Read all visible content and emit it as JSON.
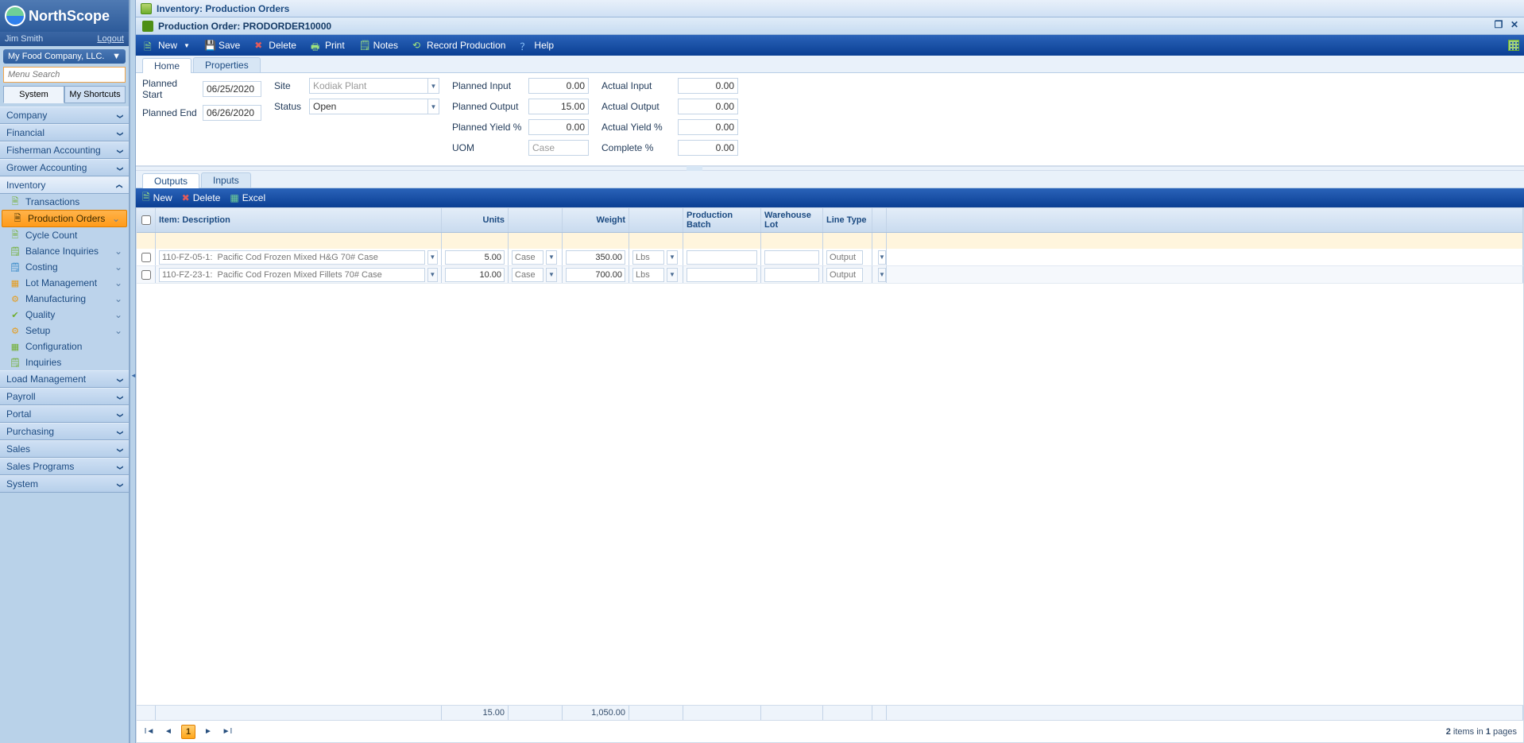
{
  "brand": "NorthScope",
  "user": {
    "name": "Jim Smith",
    "logout": "Logout"
  },
  "company": "My Food Company, LLC.",
  "menu_search_placeholder": "Menu Search",
  "side_tabs": {
    "system": "System",
    "shortcuts": "My Shortcuts"
  },
  "nav_groups_top": [
    "Company",
    "Financial",
    "Fisherman Accounting",
    "Grower Accounting"
  ],
  "nav_inventory": {
    "label": "Inventory",
    "items": [
      {
        "label": "Transactions",
        "icon": "📄",
        "color": "#6fae2e"
      },
      {
        "label": "Production Orders",
        "selected": true,
        "icon": "📋",
        "color": "#fff"
      },
      {
        "label": "Cycle Count",
        "icon": "🗎",
        "color": "#6fae2e"
      },
      {
        "label": "Balance Inquiries",
        "chev": true,
        "icon": "🗒",
        "color": "#6fae2e"
      },
      {
        "label": "Costing",
        "chev": true,
        "icon": "🗒",
        "color": "#2d83c5"
      },
      {
        "label": "Lot Management",
        "chev": true,
        "icon": "▦",
        "color": "#e69b1a"
      },
      {
        "label": "Manufacturing",
        "chev": true,
        "icon": "⚙",
        "color": "#e69b1a"
      },
      {
        "label": "Quality",
        "chev": true,
        "icon": "✔",
        "color": "#6fae2e"
      },
      {
        "label": "Setup",
        "chev": true,
        "icon": "⚙",
        "color": "#e69b1a"
      },
      {
        "label": "Configuration",
        "icon": "▦",
        "color": "#6fae2e"
      },
      {
        "label": "Inquiries",
        "icon": "🗒",
        "color": "#6fae2e"
      }
    ]
  },
  "nav_groups_bottom": [
    "Load Management",
    "Payroll",
    "Portal",
    "Purchasing",
    "Sales",
    "Sales Programs",
    "System"
  ],
  "window_title": "Inventory: Production Orders",
  "doc_title": "Production Order: PRODORDER10000",
  "toolbar": {
    "new": "New",
    "save": "Save",
    "delete": "Delete",
    "print": "Print",
    "notes": "Notes",
    "record": "Record Production",
    "help": "Help"
  },
  "page_tabs": {
    "home": "Home",
    "properties": "Properties"
  },
  "form": {
    "planned_start_label": "Planned Start",
    "planned_start": "06/25/2020",
    "planned_end_label": "Planned End",
    "planned_end": "06/26/2020",
    "site_label": "Site",
    "site": "Kodiak Plant",
    "status_label": "Status",
    "status": "Open",
    "planned_input_label": "Planned Input",
    "planned_input": "0.00",
    "planned_output_label": "Planned Output",
    "planned_output": "15.00",
    "planned_yield_label": "Planned Yield %",
    "planned_yield": "0.00",
    "uom_label": "UOM",
    "uom": "Case",
    "actual_input_label": "Actual Input",
    "actual_input": "0.00",
    "actual_output_label": "Actual Output",
    "actual_output": "0.00",
    "actual_yield_label": "Actual Yield %",
    "actual_yield": "0.00",
    "complete_label": "Complete %",
    "complete": "0.00"
  },
  "detail_tabs": {
    "outputs": "Outputs",
    "inputs": "Inputs"
  },
  "detail_toolbar": {
    "new": "New",
    "delete": "Delete",
    "excel": "Excel"
  },
  "grid": {
    "headers": {
      "item": "Item: Description",
      "units": "Units",
      "weight": "Weight",
      "batch": "Production Batch",
      "lot": "Warehouse Lot",
      "ltype": "Line Type"
    },
    "rows": [
      {
        "item": "110-FZ-05-1:  Pacific Cod Frozen Mixed H&G 70# Case",
        "units": "5.00",
        "units_uom": "Case",
        "weight": "350.00",
        "weight_uom": "Lbs",
        "batch": "",
        "lot": "",
        "ltype": "Output"
      },
      {
        "item": "110-FZ-23-1:  Pacific Cod Frozen Mixed Fillets 70# Case",
        "units": "10.00",
        "units_uom": "Case",
        "weight": "700.00",
        "weight_uom": "Lbs",
        "batch": "",
        "lot": "",
        "ltype": "Output"
      }
    ],
    "totals": {
      "units": "15.00",
      "weight": "1,050.00"
    }
  },
  "pager": {
    "page": "1",
    "summary_prefix": "",
    "count": "2",
    "mid": " items in ",
    "pages": "1",
    "suffix": " pages"
  }
}
